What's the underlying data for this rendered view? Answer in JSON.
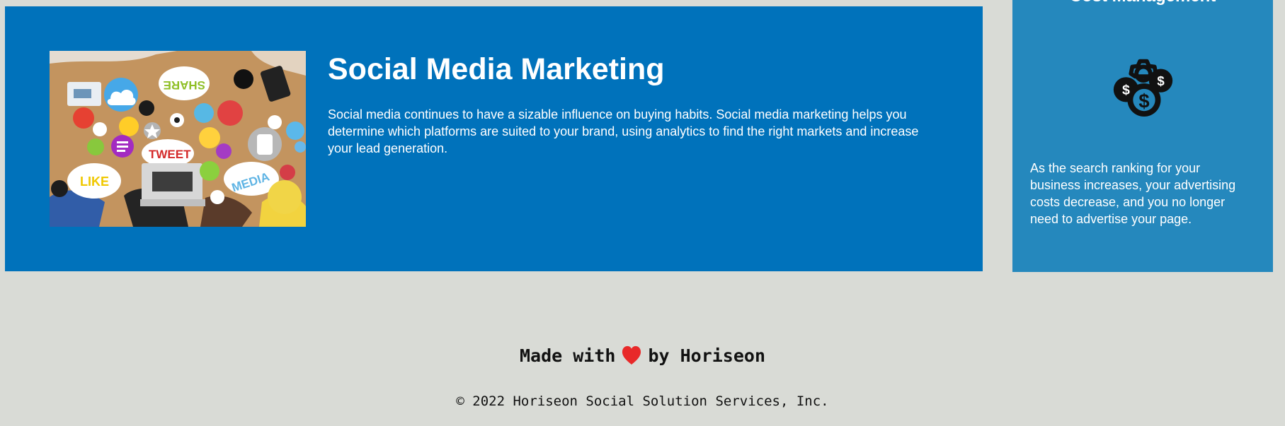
{
  "marketing": {
    "title": "Social Media Marketing",
    "text": "Social media continues to have a sizable influence on buying habits. Social media marketing helps you determine which platforms are suited to your brand, using analytics to find the right markets and increase your lead generation.",
    "image_labels": {
      "share": "SHARE",
      "tweet": "TWEET",
      "like": "LIKE",
      "media": "MEDIA"
    }
  },
  "sidebar": {
    "title": "Cost Management",
    "text": "As the search ranking for your business increases, your advertising costs decrease, and you no longer need to advertise your page.",
    "icon": "cost-management-icon"
  },
  "footer": {
    "made_with_before": "Made with",
    "made_with_after": "by Horiseon",
    "heart_icon": "heart-icon",
    "copyright": "© 2022 Horiseon Social Solution Services, Inc."
  },
  "colors": {
    "page_background": "#d9dbd6",
    "marketing_background": "#0072bb",
    "sidebar_background": "#2588bd",
    "heart": "#e82929"
  }
}
